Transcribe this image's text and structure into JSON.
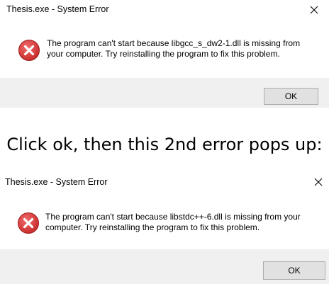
{
  "dialog1": {
    "title": "Thesis.exe - System Error",
    "message_line1": "The program can't start because libgcc_s_dw2-1.dll is missing from",
    "message_line2": "your computer. Try reinstalling the program to fix this problem.",
    "ok_label": "OK",
    "icon": "error-icon",
    "close_icon": "close-icon"
  },
  "caption": "Click ok, then this 2nd error pops up:",
  "dialog2": {
    "title": "Thesis.exe - System Error",
    "message_line1": "The program can't start because libstdc++-6.dll is missing from your",
    "message_line2": "computer. Try reinstalling the program to fix this problem.",
    "ok_label": "OK",
    "icon": "error-icon",
    "close_icon": "close-icon"
  },
  "colors": {
    "error_red": "#d32f2f",
    "footer_bg": "#f0f0f0",
    "button_bg": "#e1e1e1",
    "button_border": "#adadad"
  }
}
